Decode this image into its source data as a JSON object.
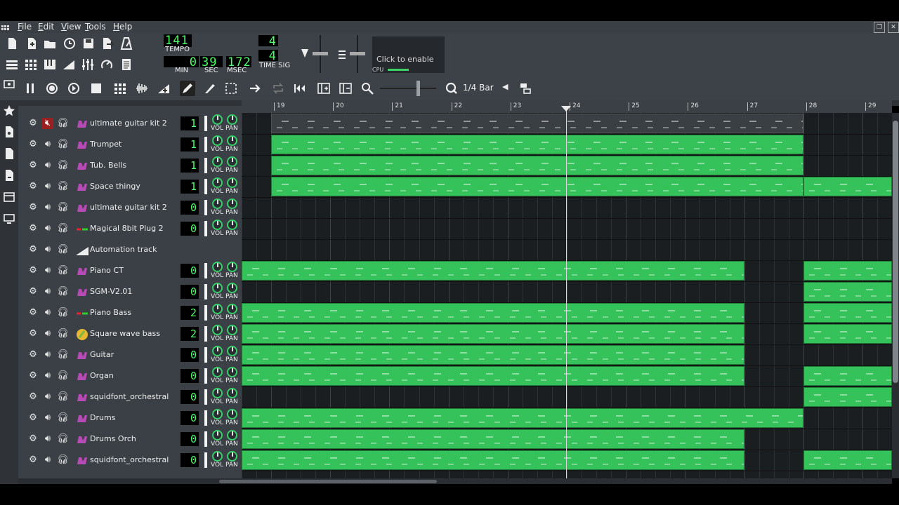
{
  "menu": {
    "items": [
      "File",
      "Edit",
      "View",
      "Tools",
      "Help"
    ]
  },
  "toolbar": {
    "tempo": {
      "value": "141",
      "label": "TEMPO"
    },
    "time": {
      "min_value": "0",
      "min_label": "MIN",
      "sec_value": "39",
      "sec_label": "SEC",
      "msec_value": "172",
      "msec_label": "MSEC"
    },
    "timesig": {
      "numerator": "4",
      "denominator": "4",
      "label": "TIME SIG"
    },
    "cpu": {
      "click_text": "Click to enable",
      "label": "CPU"
    },
    "snap": "1/4 Bar"
  },
  "timeline": {
    "bars": [
      "19",
      "20",
      "21",
      "22",
      "23",
      "24",
      "25",
      "26",
      "27",
      "28",
      "29"
    ]
  },
  "knob_labels": {
    "vol": "VOL",
    "pan": "PAN"
  },
  "tracks": [
    {
      "name": "ultimate guitar kit 2",
      "lcd": "1",
      "muted": true,
      "type": "instrument"
    },
    {
      "name": "Trumpet",
      "lcd": "1",
      "muted": false,
      "type": "instrument"
    },
    {
      "name": "Tub. Bells",
      "lcd": "1",
      "muted": false,
      "type": "instrument"
    },
    {
      "name": "Space thingy",
      "lcd": "1",
      "muted": false,
      "type": "instrument"
    },
    {
      "name": "ultimate guitar kit 2",
      "lcd": "0",
      "muted": false,
      "type": "instrument"
    },
    {
      "name": "Magical 8bit Plug 2",
      "lcd": "0",
      "muted": false,
      "type": "instrument"
    },
    {
      "name": "Automation track",
      "lcd": "",
      "muted": false,
      "type": "automation"
    },
    {
      "name": "Piano CT",
      "lcd": "0",
      "muted": false,
      "type": "instrument"
    },
    {
      "name": "SGM-V2.01",
      "lcd": "0",
      "muted": false,
      "type": "instrument"
    },
    {
      "name": "Piano Bass",
      "lcd": "2",
      "muted": false,
      "type": "instrument"
    },
    {
      "name": "Square wave bass",
      "lcd": "2",
      "muted": false,
      "type": "instrument"
    },
    {
      "name": "Guitar",
      "lcd": "0",
      "muted": false,
      "type": "instrument"
    },
    {
      "name": "Organ",
      "lcd": "0",
      "muted": false,
      "type": "instrument"
    },
    {
      "name": "squidfont_orchestral",
      "lcd": "0",
      "muted": false,
      "type": "instrument"
    },
    {
      "name": "Drums",
      "lcd": "0",
      "muted": false,
      "type": "instrument"
    },
    {
      "name": "Drums Orch",
      "lcd": "0",
      "muted": false,
      "type": "instrument"
    },
    {
      "name": "squidfont_orchestral",
      "lcd": "0",
      "muted": false,
      "type": "instrument"
    }
  ],
  "patterns": [
    [
      {
        "start": 19,
        "end": 28,
        "style": "grey"
      }
    ],
    [
      {
        "start": 19,
        "end": 28
      }
    ],
    [
      {
        "start": 19,
        "end": 28
      }
    ],
    [
      {
        "start": 19,
        "end": 28
      },
      {
        "start": 28,
        "end": 29.5
      }
    ],
    [],
    [],
    [],
    [
      {
        "start": 18.5,
        "end": 27
      },
      {
        "start": 28,
        "end": 29.5
      }
    ],
    [
      {
        "start": 28,
        "end": 29.5
      }
    ],
    [
      {
        "start": 18.5,
        "end": 27
      },
      {
        "start": 28,
        "end": 29.5
      }
    ],
    [
      {
        "start": 18.5,
        "end": 27
      },
      {
        "start": 28,
        "end": 29.5
      }
    ],
    [
      {
        "start": 18.5,
        "end": 27
      }
    ],
    [
      {
        "start": 18.5,
        "end": 27
      },
      {
        "start": 28,
        "end": 29.5
      }
    ],
    [
      {
        "start": 28,
        "end": 29.5
      }
    ],
    [
      {
        "start": 18.5,
        "end": 28
      }
    ],
    [
      {
        "start": 18.5,
        "end": 27
      }
    ],
    [
      {
        "start": 18.5,
        "end": 27
      },
      {
        "start": 28,
        "end": 29.5
      }
    ]
  ],
  "playhead_bar": 24,
  "colors": {
    "pattern": "#35c25a",
    "lcd": "#4dff6a",
    "mute_active": "#9b1f1f",
    "panel": "#3b4046"
  }
}
